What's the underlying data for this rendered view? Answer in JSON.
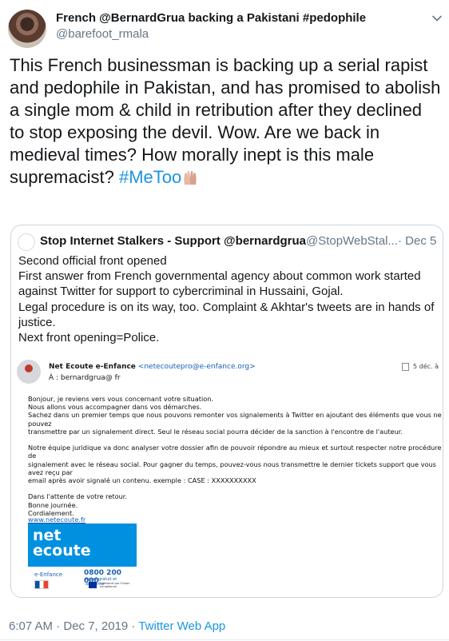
{
  "tweet": {
    "display_name": "French @BernardGrua backing a Pakistani #pedophile",
    "handle": "@barefoot_rmala",
    "text": "This French businessman is backing up a serial rapist and pedophile in Pakistan, and has promised to abolish a single mom & child in retribution after they declined to stop exposing the devil. Wow. Are we back in medieval times? How morally inept is this male supremacist? ",
    "hashtag": "#MeToo",
    "emoji_name": "raised-hands-emoji",
    "timestamp": "6:07 AM · Dec 7, 2019",
    "separator": " · ",
    "client": "Twitter Web App",
    "menu_icon": "chevron-down-icon"
  },
  "quoted_tweet": {
    "display_name": "Stop Internet Stalkers - Support @bernardgrua",
    "handle": "@StopWebStal...",
    "date": "· Dec 5",
    "text": "Second official front opened\nFirst answer from French governmental agency about common work started against Twitter for support to cybercriminal in Hussaini, Gojal.\nLegal procedure is on its way, too. Complaint & Akhtar's tweets are in hands of justice.\nNext front opening=Police."
  },
  "email_image": {
    "sender_name": "Net Ecoute e-Enfance",
    "sender_address": "<netecoutepro@e-enfance.org>",
    "to_line": "À : bernardgrua@            fr",
    "date": "5 déc. à",
    "body": "Bonjour, je reviens vers vous concernant votre situation.\nNous allons vous accompagner dans vos démarches.\nSachez dans un premier temps que nous pouvons remonter vos signalements à Twitter en ajoutant des éléments que vous ne pouvez\ntransmettre par un signalement direct. Seul le réseau social pourra décider de la sanction à l'encontre de l'auteur.\n\nNotre équipe juridique va donc analyser votre dossier afin de pouvoir répondre au mieux et surtout respecter notre procédure de\nsignalement avec le réseau social. Pour gagner du temps, pouvez-vous nous transmettre le dernier tickets support que vous avez reçu par\nemail après avoir signalé un contenu. exemple : CASE : XXXXXXXXXX\n\nDans l'attente de votre retour.\nBonne journée.\nCordialement.\n\n--\nL'équipe Net Ecoute.",
    "link": "www.netecoute.fr",
    "logo_text": "net\necoute",
    "logo_subtext": "e-Enfance",
    "phone": "0800 200 000",
    "phone_caption": "Appel gratuit et anonyme",
    "eu_caption": "Cofinancé par l'Union européenne"
  },
  "colors": {
    "link_blue": "#1b95e0",
    "muted_gray": "#657786",
    "netecoute_blue": "#0090e0"
  }
}
